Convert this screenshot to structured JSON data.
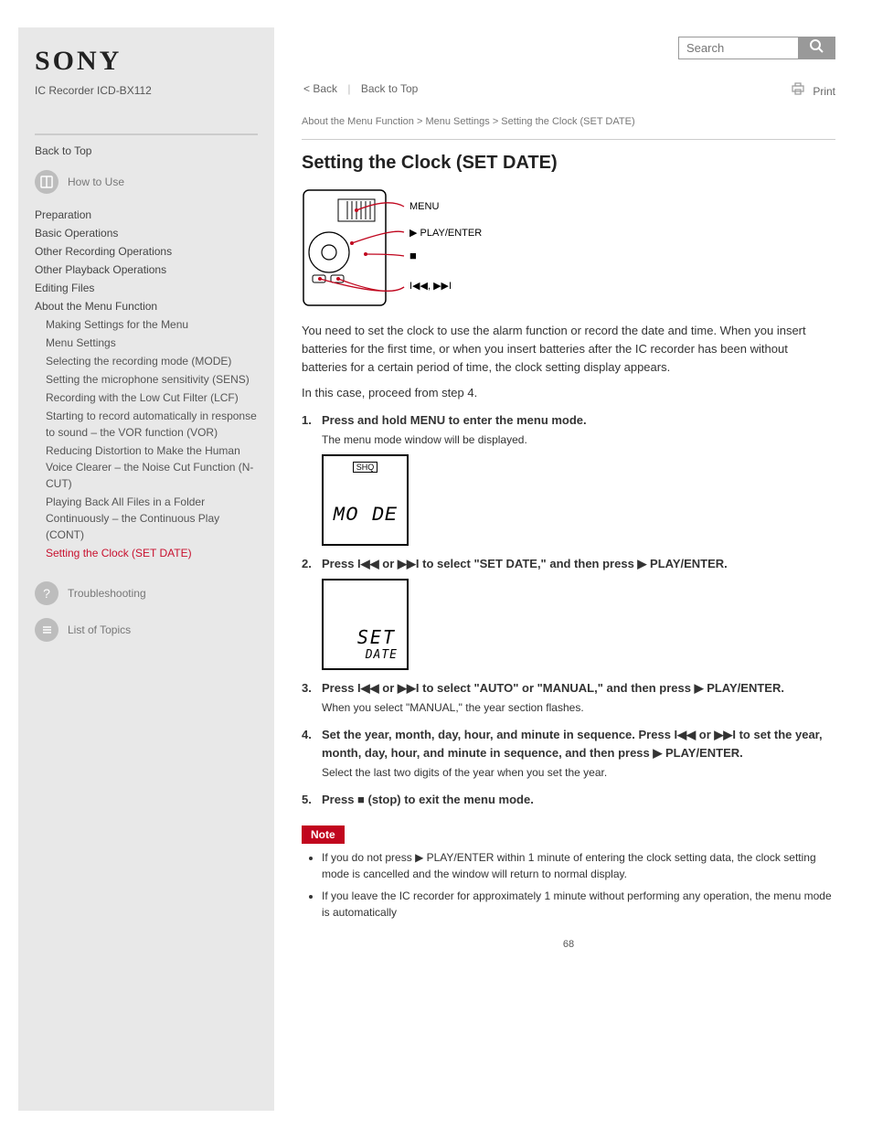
{
  "brand": "SONY",
  "model": "IC Recorder ICD-BX112",
  "search": {
    "placeholder": "Search"
  },
  "sidebar": {
    "back_label": "Back to Top",
    "toc": {
      "items": [
        "Preparation",
        "Basic Operations",
        "Other Recording Operations",
        "Other Playback Operations",
        "Editing Files",
        "About the Menu Function",
        "Making Settings for the Menu",
        "Menu Settings"
      ],
      "sub_items": [
        "Selecting the recording mode (MODE)",
        "Setting the microphone sensitivity (SENS)",
        "Recording with the Low Cut Filter (LCF)",
        "Starting to record automatically in response to sound – the VOR function (VOR)",
        "Reducing Distortion to Make the Human Voice Clearer – the Noise Cut Function (N-CUT)",
        "Playing Back All Files in a Folder Continuously – the Continuous Play (CONT)",
        "Setting the Clock (SET DATE)"
      ],
      "active": "Setting the Clock (SET DATE)"
    },
    "troubleshooting": "Troubleshooting",
    "listtopics": "List of Topics"
  },
  "toolbar": {
    "back": "< Back",
    "backtotop": "Back to Top",
    "print": "Print"
  },
  "breadcrumb": "About the Menu Function > Menu Settings > Setting the Clock (SET DATE)",
  "title": "Setting the Clock (SET DATE)",
  "labels": {
    "menu": "MENU",
    "play_enter": "PLAY/ENTER"
  },
  "intro": "You need to set the clock to use the alarm function or record the date and time. When you insert batteries for the first time, or when you insert batteries after the IC recorder has been without batteries for a certain period of time, the clock setting display appears.",
  "intro2": "In this case, proceed from step 4.",
  "steps": [
    {
      "num": "1.",
      "txt": "Press and hold MENU to enter the menu mode.",
      "sub": "The menu mode window will be displayed."
    },
    {
      "num": "2.",
      "txt_pre": "Press ",
      "txt_mid": " or ",
      "txt_post": " to select \"SET DATE,\" and then press ",
      "txt_end": " PLAY/ENTER."
    },
    {
      "num": "3.",
      "txt_pre": "Press ",
      "txt_mid": " or ",
      "txt_post": " to select \"AUTO\" or \"MANUAL,\" and then press ",
      "txt_end": " PLAY/ENTER.",
      "sub": "When you select \"MANUAL,\" the year section flashes."
    },
    {
      "num": "4.",
      "txt_pre": "Set the year, month, day, hour, and minute in sequence. Press ",
      "txt_mid": " or ",
      "txt_post": " to set the year, month, day, hour, and minute in sequence, and then press ",
      "txt_end": " PLAY/ENTER.",
      "sub": "Select the last two digits of the year when you set the year."
    },
    {
      "num": "5.",
      "txt_pre": "Press ",
      "txt_post": " (stop) to exit the menu mode."
    }
  ],
  "lcd1": {
    "badge": "SHQ",
    "text": "MO DE"
  },
  "lcd2": {
    "line1": "SET",
    "line2": "DATE"
  },
  "note_label": "Note",
  "notes": [
    "If you do not press  PLAY/ENTER within 1 minute of entering the clock setting data, the clock setting mode is cancelled and the window will return to normal display.",
    "If you leave the IC recorder for approximately 1 minute without performing any operation, the menu mode is automatically"
  ],
  "glyphs": {
    "prev": "I◀◀",
    "next": "▶▶I",
    "play": "▶",
    "stop": "■"
  },
  "page_number": "68"
}
